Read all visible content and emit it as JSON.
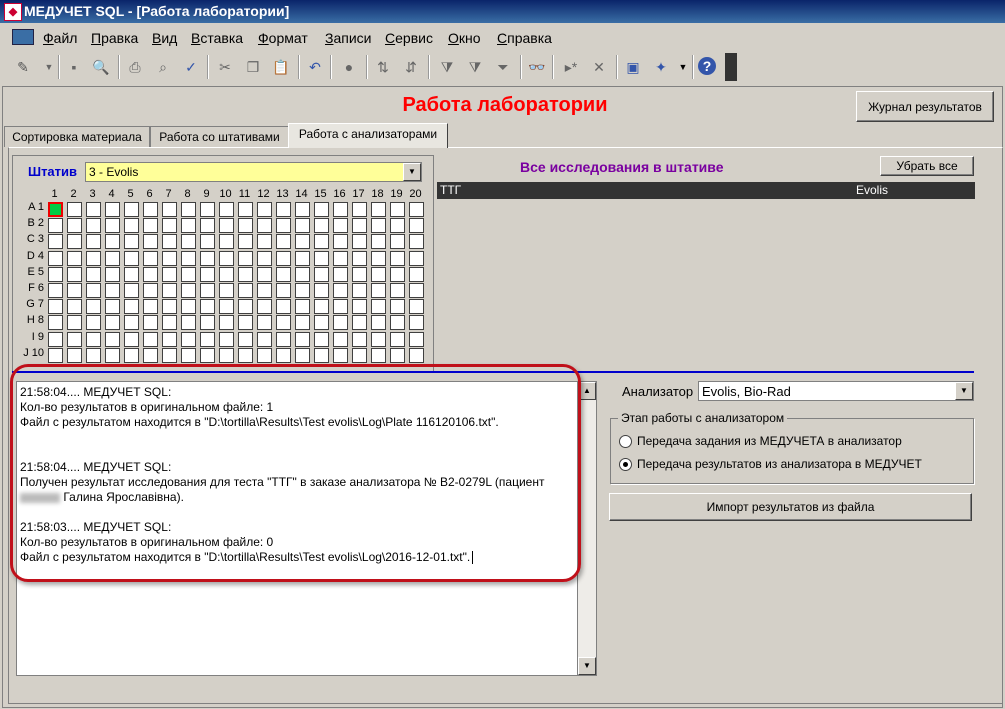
{
  "window": {
    "title": "МЕДУЧЕТ SQL - [Работа лаборатории]"
  },
  "menu": [
    "Файл",
    "Правка",
    "Вид",
    "Вставка",
    "Формат",
    "Записи",
    "Сервис",
    "Окно",
    "Справка"
  ],
  "toolbar_icons": [
    "design-view-icon",
    "save-icon",
    "preview-icon",
    "print-icon",
    "print-preview-icon",
    "spellcheck-icon",
    "cut-icon",
    "copy-icon",
    "paste-icon",
    "undo-icon",
    "hyperlink-icon",
    "sort-asc-icon",
    "sort-desc-icon",
    "filter-selection-icon",
    "filter-form-icon",
    "apply-filter-icon",
    "find-icon",
    "new-record-icon",
    "delete-record-icon",
    "database-window-icon",
    "new-object-icon",
    "help-icon"
  ],
  "header": {
    "title": "Работа лаборатории",
    "journal_button": "Журнал результатов"
  },
  "tabs": [
    {
      "label": "Сортировка материала",
      "active": false
    },
    {
      "label": "Работа со штативами",
      "active": false
    },
    {
      "label": "Работа с анализаторами",
      "active": true
    }
  ],
  "rack": {
    "label": "Штатив",
    "selected": "3 - Evolis",
    "columns": [
      "1",
      "2",
      "3",
      "4",
      "5",
      "6",
      "7",
      "8",
      "9",
      "10",
      "11",
      "12",
      "13",
      "14",
      "15",
      "16",
      "17",
      "18",
      "19",
      "20"
    ],
    "rows": [
      "A 1",
      "B 2",
      "C 3",
      "D 4",
      "E 5",
      "F 6",
      "G 7",
      "H 8",
      "I 9",
      "J 10"
    ],
    "selected_cell": "A1"
  },
  "studies": {
    "title": "Все исследования в штативе",
    "remove_all_button": "Убрать все",
    "rows": [
      {
        "test": "ТТГ",
        "analyzer": "Evolis"
      }
    ]
  },
  "log": {
    "blocks": [
      [
        "21:58:04.... МЕДУЧЕТ SQL:",
        "Кол-во результатов в оригинальном файле: 1",
        "Файл с результатом находится в \"D:\\tortilla\\Results\\Test evolis\\Log\\Plate 116120106.txt\"."
      ],
      [
        "21:58:04.... МЕДУЧЕТ SQL:",
        "Получен результат исследования для теста \"ТТГ\" в заказе анализатора № В2-0279L (пациент",
        "Галина Ярославівна)."
      ],
      [
        "21:58:03.... МЕДУЧЕТ SQL:",
        "Кол-во результатов в оригинальном файле: 0",
        "Файл с результатом находится в \"D:\\tortilla\\Results\\Test evolis\\Log\\2016-12-01.txt\"."
      ]
    ]
  },
  "analyzer": {
    "label": "Анализатор",
    "selected": "Evolis, Bio-Rad",
    "stage_group_title": "Этап работы с анализатором",
    "options": [
      {
        "label": "Передача задания из МЕДУЧЕТА в анализатор",
        "checked": false
      },
      {
        "label": "Передача результатов из анализатора в МЕДУЧЕТ",
        "checked": true
      }
    ],
    "import_button": "Импорт результатов из файла"
  }
}
